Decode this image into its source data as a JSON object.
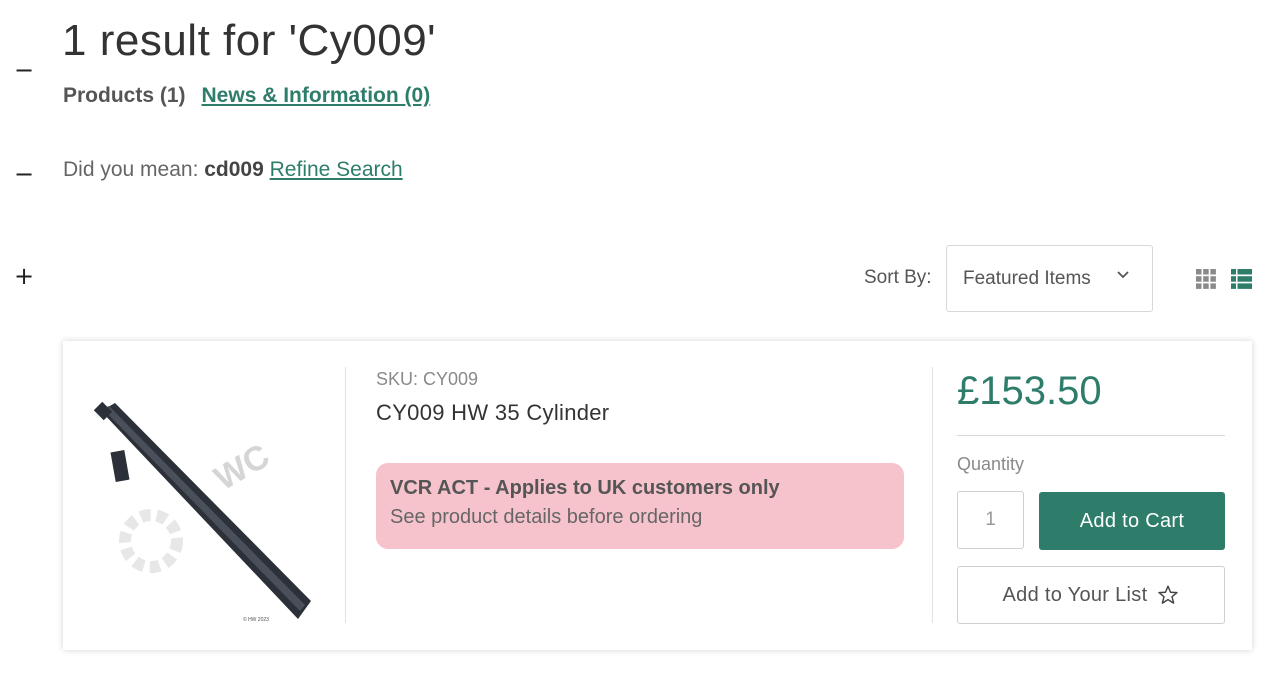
{
  "header": {
    "title": "1 result for 'Cy009'",
    "tabs": [
      {
        "label": "Products (1)",
        "active": true
      },
      {
        "label": "News & Information (0)",
        "active": false
      }
    ]
  },
  "toggles": [
    "−",
    "−",
    "+"
  ],
  "suggestion": {
    "prefix": "Did you mean:",
    "term": "cd009",
    "refine_label": "Refine Search"
  },
  "sort": {
    "label": "Sort By:",
    "selected": "Featured Items"
  },
  "view_modes": {
    "grid_icon": "grid-icon",
    "list_icon": "list-icon",
    "active": "list"
  },
  "product": {
    "sku": "SKU: CY009",
    "name": "CY009 HW 35 Cylinder",
    "notice_title": "VCR ACT - Applies to UK customers only",
    "notice_text": "See product details before ordering",
    "price": "£153.50",
    "quantity_label": "Quantity",
    "quantity_value": "1",
    "add_to_cart_label": "Add to Cart",
    "add_to_list_label": "Add to Your List"
  },
  "colors": {
    "accent": "#2e7d6b",
    "notice_bg": "#f6c3cc"
  }
}
